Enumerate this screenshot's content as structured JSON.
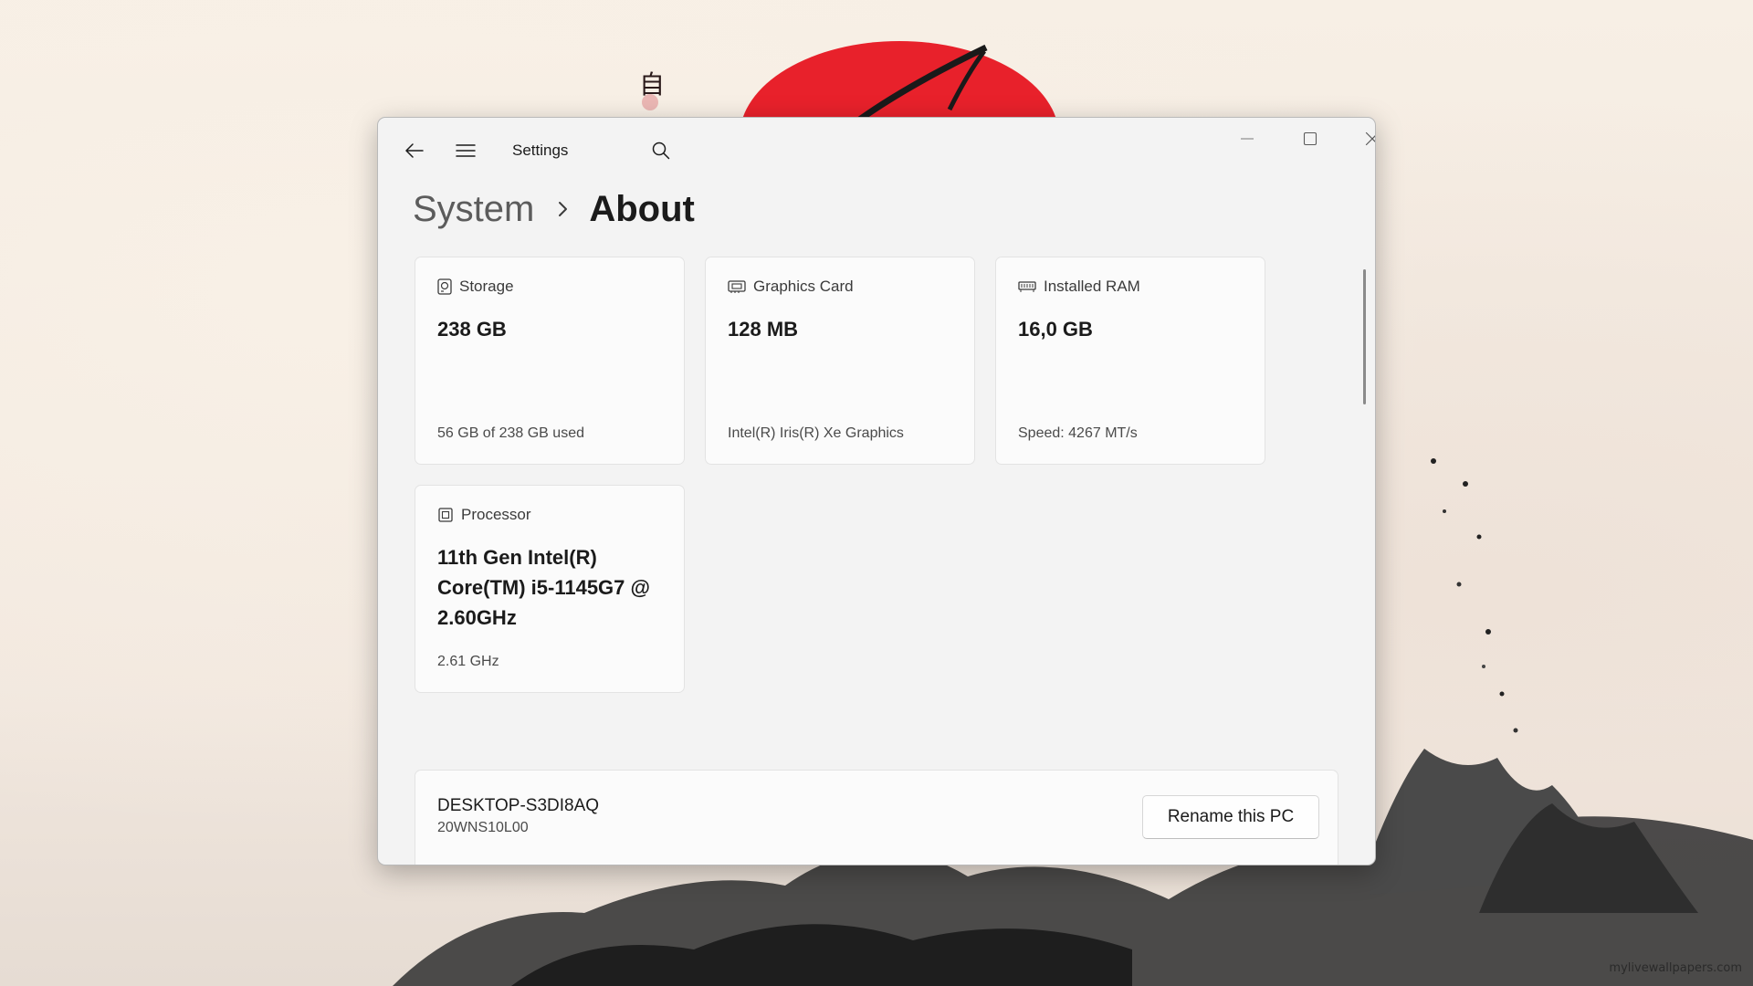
{
  "window": {
    "app_title": "Settings",
    "back_icon": "back-arrow-icon",
    "menu_icon": "hamburger-menu-icon",
    "search_icon": "search-icon"
  },
  "breadcrumb": {
    "parent": "System",
    "separator_icon": "chevron-right-icon",
    "current": "About"
  },
  "specs": {
    "storage": {
      "icon": "storage-drive-icon",
      "label": "Storage",
      "value": "238 GB",
      "detail": "56 GB of 238 GB used"
    },
    "graphics": {
      "icon": "graphics-card-icon",
      "label": "Graphics Card",
      "value": "128 MB",
      "detail": "Intel(R) Iris(R) Xe Graphics"
    },
    "ram": {
      "icon": "memory-icon",
      "label": "Installed RAM",
      "value": "16,0 GB",
      "detail": "Speed: 4267 MT/s"
    },
    "processor": {
      "icon": "processor-chip-icon",
      "label": "Processor",
      "value": "11th Gen Intel(R) Core(TM) i5-1145G7 @ 2.60GHz",
      "detail": "2.61 GHz"
    }
  },
  "device": {
    "name": "DESKTOP-S3DI8AQ",
    "model": "20WNS10L00",
    "rename_label": "Rename this PC"
  },
  "desktop": {
    "watermark": "mylivewallpapers.com",
    "sun_color": "#e8202a"
  }
}
